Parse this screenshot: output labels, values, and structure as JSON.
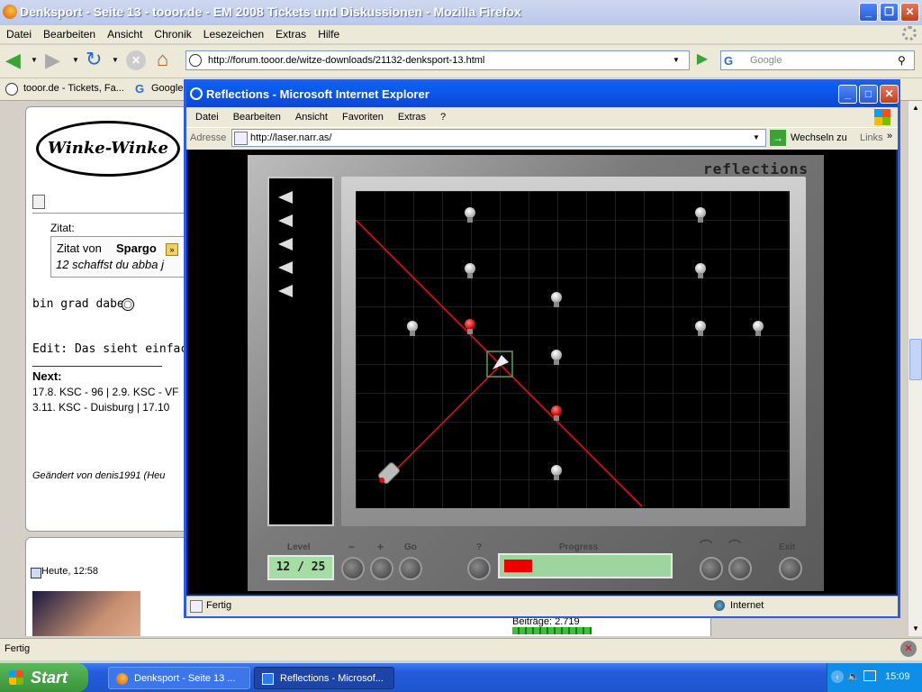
{
  "firefox": {
    "title": "Denksport - Seite 13 - tooor.de - EM 2008 Tickets und Diskussionen - Mozilla Firefox",
    "menu": [
      "Datei",
      "Bearbeiten",
      "Ansicht",
      "Chronik",
      "Lesezeichen",
      "Extras",
      "Hilfe"
    ],
    "url": "http://forum.tooor.de/witze-downloads/21132-denksport-13.html",
    "search_placeholder": "Google",
    "bookmarks": [
      "tooor.de - Tickets, Fa...",
      "Google"
    ],
    "status": "Fertig"
  },
  "forum": {
    "logo": "Winke-Winke",
    "quote_label": "Zitat:",
    "quote_from": "Zitat von",
    "quote_author": "Spargo",
    "quote_text": "12 schaffst du abba j",
    "post_line1": "bin grad dabei",
    "post_edit": "Edit: Das sieht einfacher",
    "next_label": "Next:",
    "next_line1": "17.8. KSC - 96 | 2.9. KSC - VF",
    "next_line2": "3.11. KSC - Duisburg | 17.10",
    "edited_by": "Geändert von denis1991 (Heu",
    "date": "Heute, 12:58",
    "posts": "Beiträge: 2.719"
  },
  "ie": {
    "title": "Reflections - Microsoft Internet Explorer",
    "menu": [
      "Datei",
      "Bearbeiten",
      "Ansicht",
      "Favoriten",
      "Extras",
      "?"
    ],
    "address_label": "Adresse",
    "url": "http://laser.narr.as/",
    "go_label": "Wechseln zu",
    "links_label": "Links",
    "status": "Fertig",
    "zone": "Internet"
  },
  "game": {
    "logo": "reflections",
    "level_label": "Level",
    "level_value": "12 / 25",
    "minus_label": "−",
    "plus_label": "+",
    "go_label": "Go",
    "help_label": "?",
    "progress_label": "Progress",
    "progress_fraction": 0.17,
    "exit_label": "Exit",
    "remaining_mirrors": 5
  },
  "taskbar": {
    "start": "Start",
    "tasks": [
      "Denksport - Seite 13 ...",
      "Reflections - Microsof..."
    ],
    "clock": "15:09"
  },
  "colors": {
    "laser": "#e01010",
    "progress_fill": "#ee0000",
    "progress_bg": "#9ed49e"
  }
}
